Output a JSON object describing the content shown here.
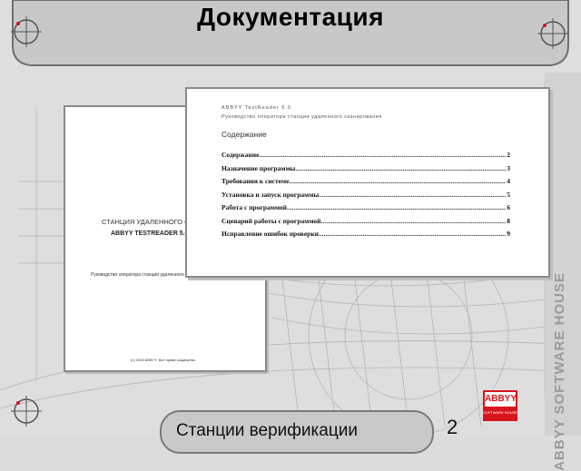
{
  "slide": {
    "title": "Документация",
    "footer_text": "Станции верификации",
    "page_number": "2",
    "vertical_brand": "ABBYY SOFTWARE HOUSE",
    "logo_main": "ABBYY",
    "logo_sub": "SOFTWARE HOUSE",
    "accent_color": "#d8141c"
  },
  "doc_back": {
    "heading1": "СТАНЦИЯ УДАЛЕННОГО СК",
    "heading2": "ABBYY TESTREADER 5.0",
    "subtitle": "Руководство оператора станции удаленного сканирования",
    "copyright": "(c) 2005 ABBYY. Все права защищены."
  },
  "doc_front": {
    "header_line1": "ABBYY TestReader 5.0",
    "header_line2": "Руководство оператора станции удаленного сканирования",
    "contents_heading": "Содержание",
    "toc": [
      {
        "title": "Содержание",
        "page": "2"
      },
      {
        "title": "Назначение программы",
        "page": "3"
      },
      {
        "title": "Требования к системе",
        "page": "4"
      },
      {
        "title": "Установка и запуск программы",
        "page": "5"
      },
      {
        "title": "Работа с программой",
        "page": "6"
      },
      {
        "title": "Сценарий работы с программой",
        "page": "8"
      },
      {
        "title": "Исправление ошибок проверки",
        "page": "9"
      }
    ]
  }
}
